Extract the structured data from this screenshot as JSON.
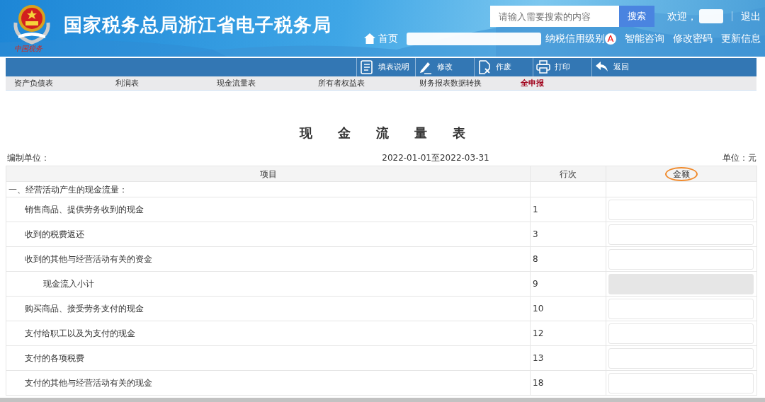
{
  "header": {
    "logo_text": "中国税务",
    "title": "国家税务总局浙江省电子税务局",
    "search": {
      "placeholder": "请输入需要搜索的内容",
      "button": "搜索"
    },
    "welcome": "欢迎，",
    "logout": "退出",
    "home": "首页",
    "credit_label": "纳税信用级别",
    "credit_grade": "A",
    "links": [
      "智能咨询",
      "修改密码",
      "更新信息"
    ]
  },
  "toolbar": [
    {
      "label": "填表说明",
      "kind": "doc"
    },
    {
      "label": "修改",
      "kind": "pen"
    },
    {
      "label": "作废",
      "kind": "void"
    },
    {
      "label": "打印",
      "kind": "print"
    },
    {
      "label": "返回",
      "kind": "back"
    }
  ],
  "tabs": [
    {
      "label": "资产负债表",
      "kind": "plain"
    },
    {
      "label": "利润表",
      "kind": "plain"
    },
    {
      "label": "现金流量表",
      "kind": "plain"
    },
    {
      "label": "所有者权益表",
      "kind": "plain"
    },
    {
      "label": "财务报表数据转换",
      "kind": "plain"
    },
    {
      "label": "全申报",
      "kind": "highlight"
    }
  ],
  "report": {
    "title": "现金流量表",
    "unit_label": "编制单位：",
    "period": "2022-01-01至2022-03-31",
    "currency": "单位：元"
  },
  "table": {
    "columns": [
      {
        "label": "项目",
        "circled": false
      },
      {
        "label": "行次",
        "circled": false
      },
      {
        "label": "金额",
        "circled": true
      }
    ],
    "rows": [
      {
        "kind": "section",
        "item": "一、经营活动产生的现金流量："
      },
      {
        "kind": "item",
        "item": "销售商品、提供劳务收到的现金",
        "line": "1",
        "disabled": false
      },
      {
        "kind": "item",
        "item": "收到的税费返还",
        "line": "3",
        "disabled": false
      },
      {
        "kind": "item",
        "item": "收到的其他与经营活动有关的资金",
        "line": "8",
        "disabled": false
      },
      {
        "kind": "subtotal",
        "item": "现金流入小计",
        "line": "9",
        "disabled": true
      },
      {
        "kind": "item",
        "item": "购买商品、接受劳务支付的现金",
        "line": "10",
        "disabled": false
      },
      {
        "kind": "item",
        "item": "支付给职工以及为支付的现金",
        "line": "12",
        "disabled": false
      },
      {
        "kind": "item",
        "item": "支付的各项税费",
        "line": "13",
        "disabled": false
      },
      {
        "kind": "item",
        "item": "支付的其他与经营活动有关的现金",
        "line": "18",
        "disabled": false
      }
    ]
  }
}
